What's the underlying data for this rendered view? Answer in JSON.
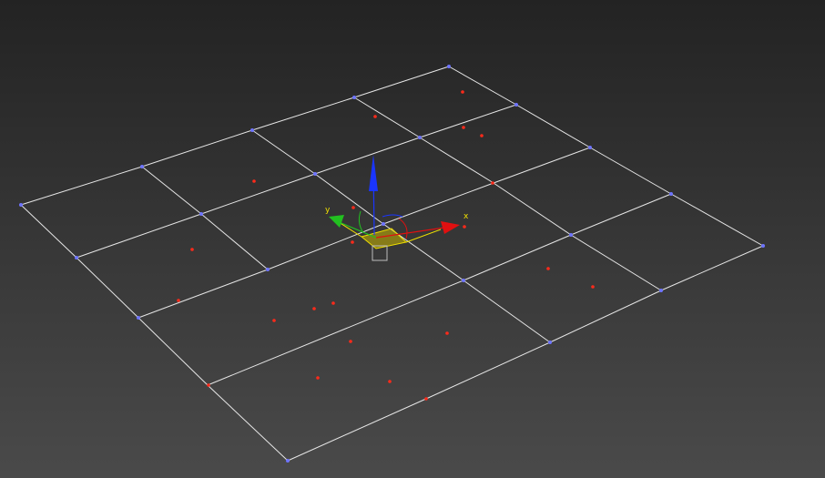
{
  "viewport": {
    "background_top": "#232323",
    "background_bottom": "#4a4a4a",
    "grid_color": "#e6e6e6",
    "vertex_color": "#6e74ff",
    "selected_vertex_color": "#ff2a1a"
  },
  "gizmo": {
    "x_label": "x",
    "y_label": "y",
    "x_color": "#e01010",
    "y_color": "#22c020",
    "z_color": "#1a35ff",
    "plane_color": "#c8b400",
    "center_box_color": "#bdbdbd"
  }
}
